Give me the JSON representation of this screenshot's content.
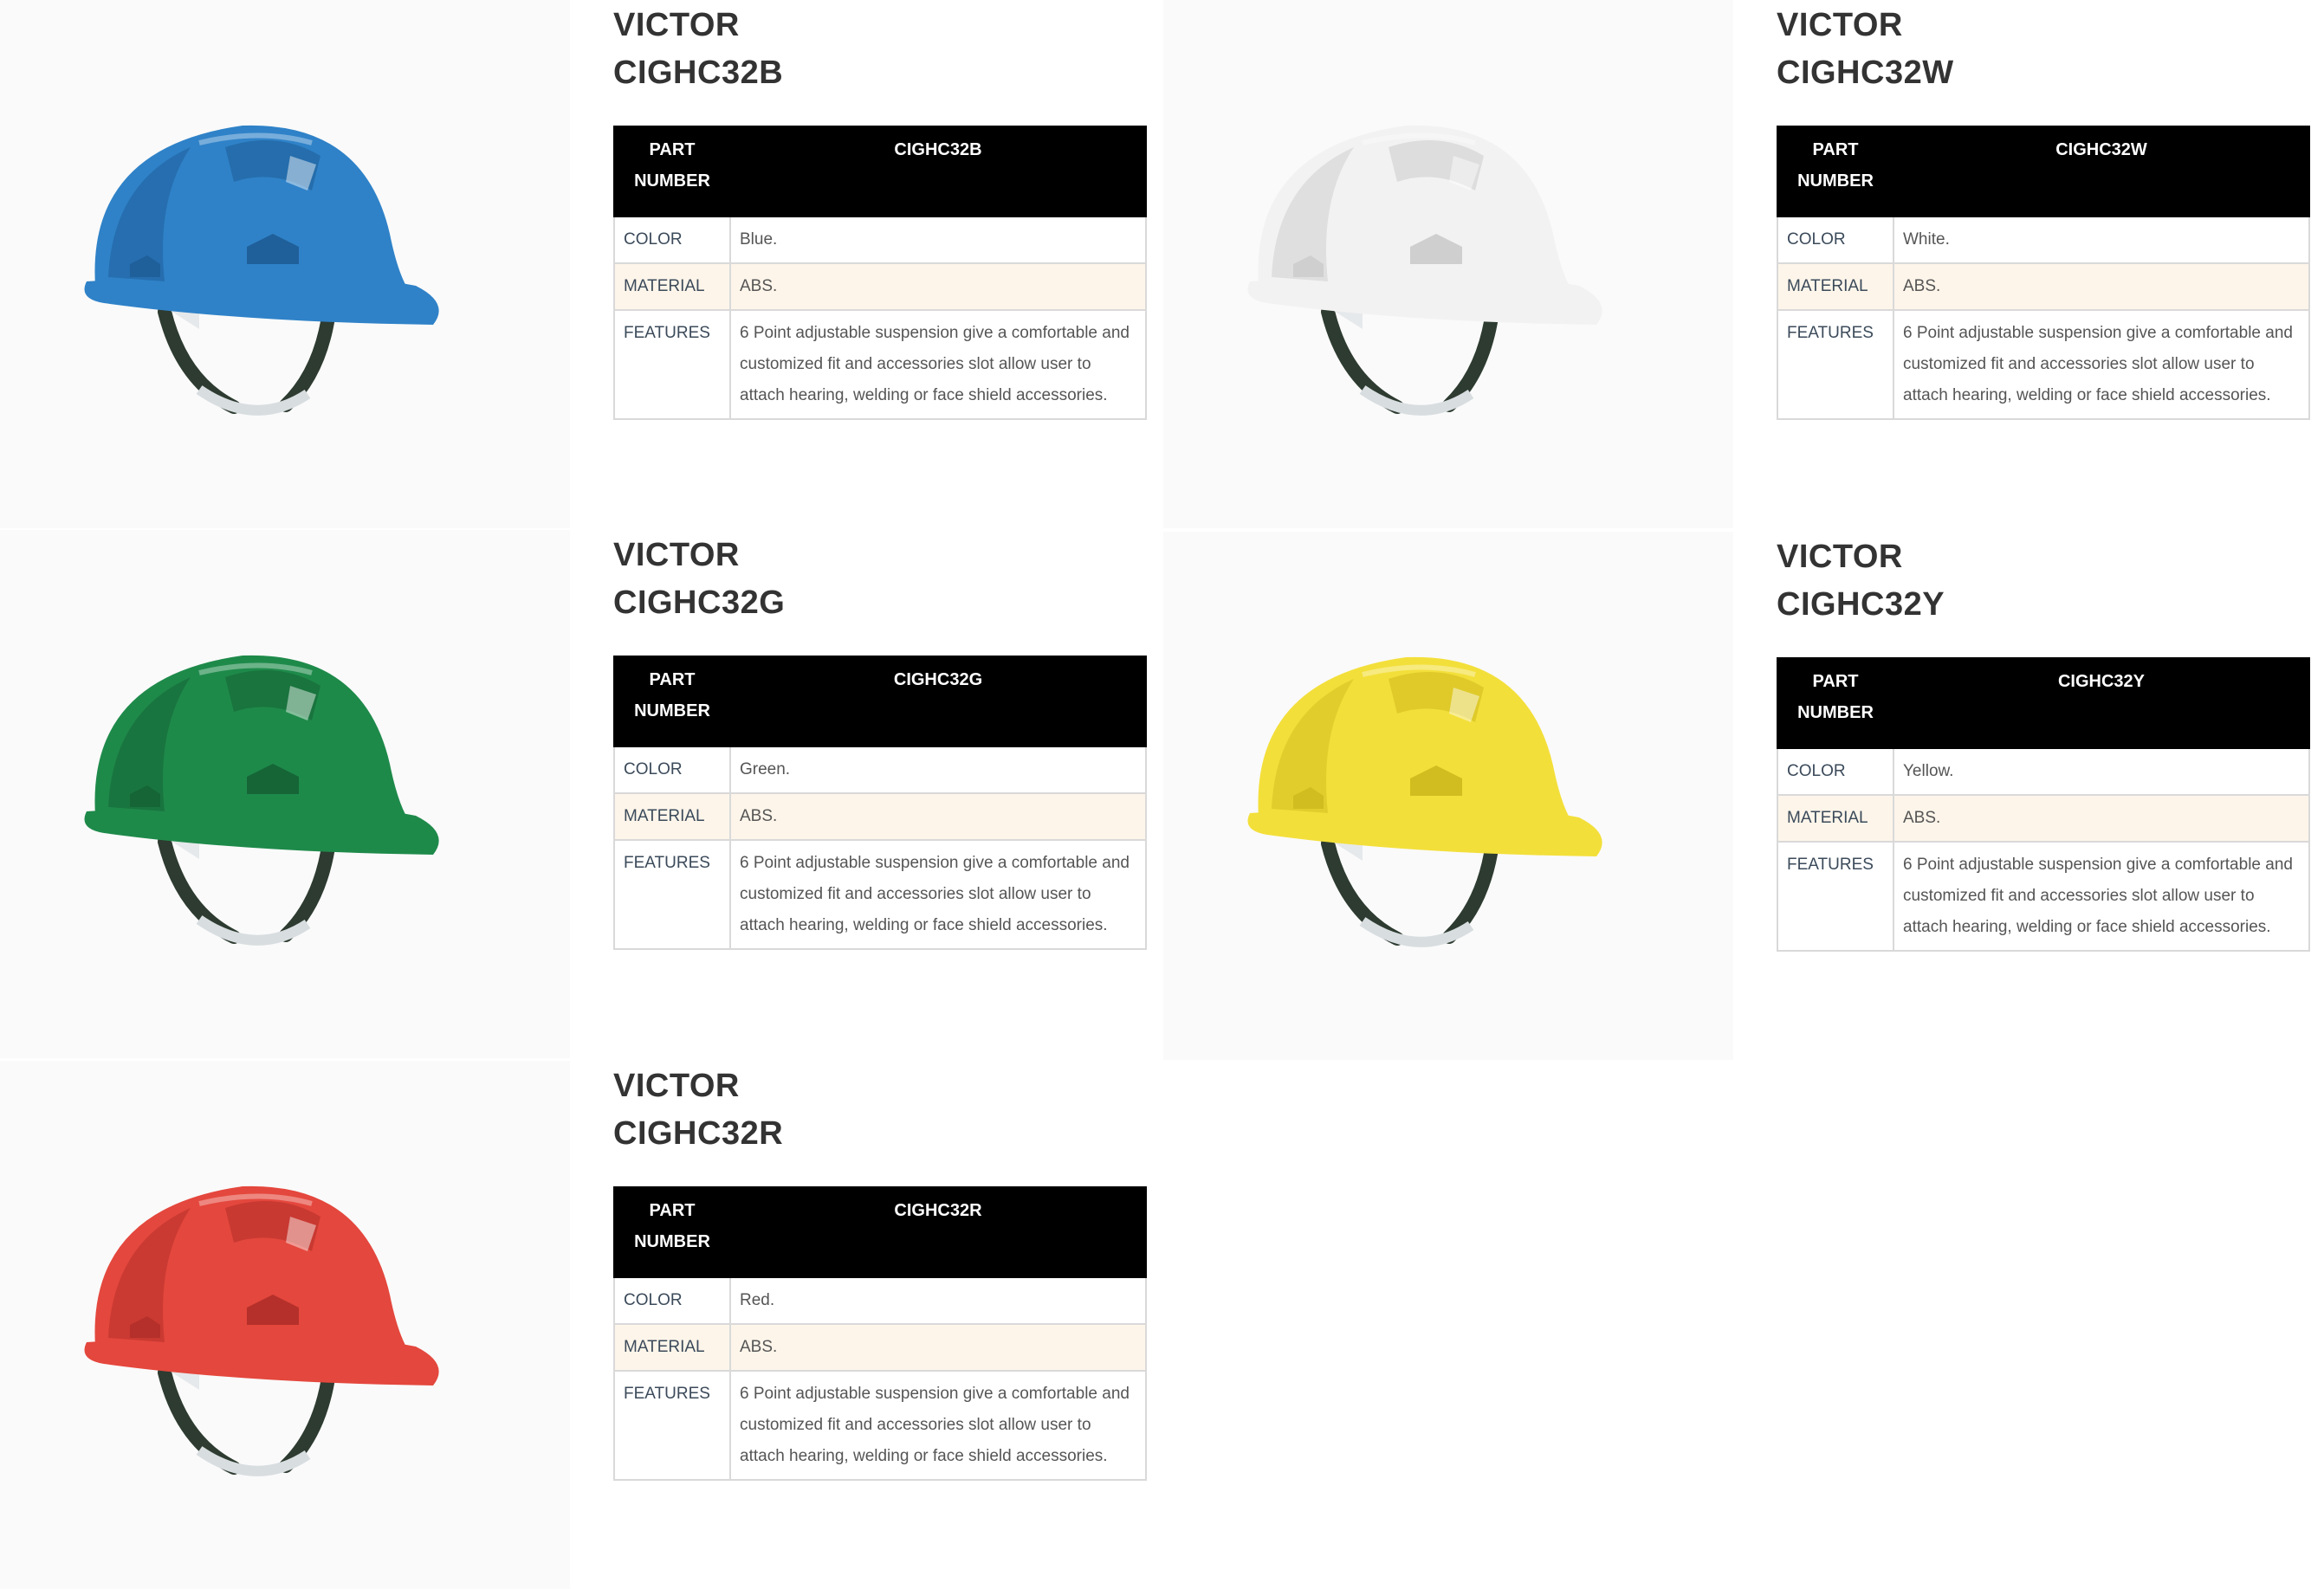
{
  "labels": {
    "part_number_line1": "PART",
    "part_number_line2": "NUMBER",
    "color": "COLOR",
    "material": "MATERIAL",
    "features": "FEATURES"
  },
  "products": [
    {
      "brand": "VICTOR",
      "model": "CIGHC32B",
      "part_number": "CIGHC32B",
      "color": "Blue.",
      "material": "ABS.",
      "features": "6 Point adjustable suspension give a comfortable and customized fit and accessories slot allow user to attach hearing, welding or face shield accessories.",
      "helmet_color": "#2f82c8",
      "helmet_shade": "#1f5f9a"
    },
    {
      "brand": "VICTOR",
      "model": "CIGHC32W",
      "part_number": "CIGHC32W",
      "color": "White.",
      "material": "ABS.",
      "features": "6 Point adjustable suspension give a comfortable and customized fit and accessories slot allow user to attach hearing, welding or face shield accessories.",
      "helmet_color": "#f2f2f2",
      "helmet_shade": "#cfcfcf"
    },
    {
      "brand": "VICTOR",
      "model": "CIGHC32G",
      "part_number": "CIGHC32G",
      "color": "Green.",
      "material": "ABS.",
      "features": "6 Point adjustable suspension give a comfortable and customized fit and accessories slot allow user to attach hearing, welding or face shield accessories.",
      "helmet_color": "#1e8a4a",
      "helmet_shade": "#156536"
    },
    {
      "brand": "VICTOR",
      "model": "CIGHC32Y",
      "part_number": "CIGHC32Y",
      "color": "Yellow.",
      "material": "ABS.",
      "features": "6 Point adjustable suspension give a comfortable and customized fit and accessories slot allow user to attach hearing, welding or face shield accessories.",
      "helmet_color": "#f3df3a",
      "helmet_shade": "#d2bd20"
    },
    {
      "brand": "VICTOR",
      "model": "CIGHC32R",
      "part_number": "CIGHC32R",
      "color": "Red.",
      "material": "ABS.",
      "features": "6 Point adjustable suspension give a comfortable and customized fit and accessories slot allow user to attach hearing, welding or face shield accessories.",
      "helmet_color": "#e4473d",
      "helmet_shade": "#b5302a"
    }
  ]
}
